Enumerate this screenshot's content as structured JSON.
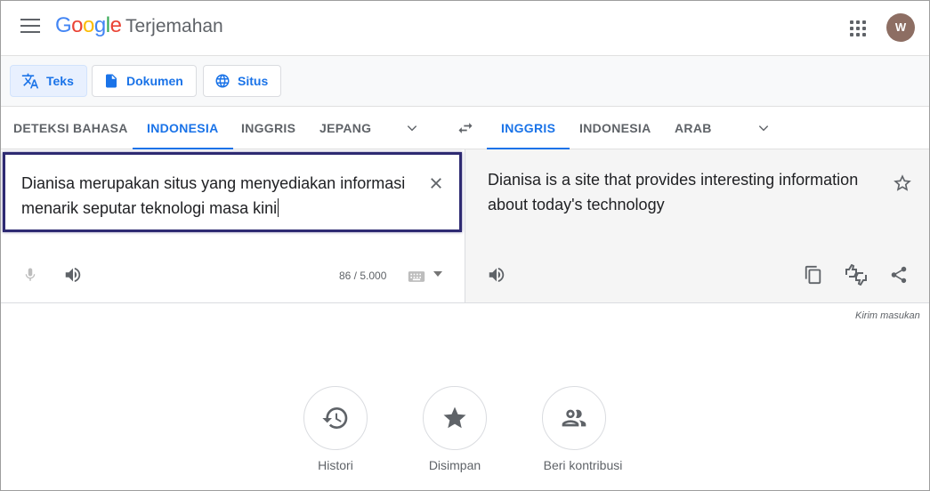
{
  "header": {
    "logo": [
      "G",
      "o",
      "o",
      "g",
      "l",
      "e"
    ],
    "product": "Terjemahan",
    "avatar_initial": "W"
  },
  "modes": [
    {
      "label": "Teks",
      "icon": "translate-icon",
      "active": true
    },
    {
      "label": "Dokumen",
      "icon": "document-icon",
      "active": false
    },
    {
      "label": "Situs",
      "icon": "globe-icon",
      "active": false
    }
  ],
  "source_langs": [
    "DETEKSI BAHASA",
    "INDONESIA",
    "INGGRIS",
    "JEPANG"
  ],
  "source_active": "INDONESIA",
  "target_langs": [
    "INGGRIS",
    "INDONESIA",
    "ARAB"
  ],
  "target_active": "INGGRIS",
  "source": {
    "text": "Dianisa merupakan situs yang menyediakan informasi menarik seputar teknologi masa kini",
    "counter": "86 / 5.000"
  },
  "target": {
    "text": "Dianisa is a site that provides interesting information about today's technology"
  },
  "feedback": "Kirim masukan",
  "shortcuts": [
    {
      "label": "Histori",
      "icon": "history-icon"
    },
    {
      "label": "Disimpan",
      "icon": "star-filled-icon"
    },
    {
      "label": "Beri kontribusi",
      "icon": "people-icon"
    }
  ],
  "colors": {
    "accent": "#1a73e8",
    "highlight_border": "#2e2a72",
    "target_bg": "#f5f5f5"
  }
}
